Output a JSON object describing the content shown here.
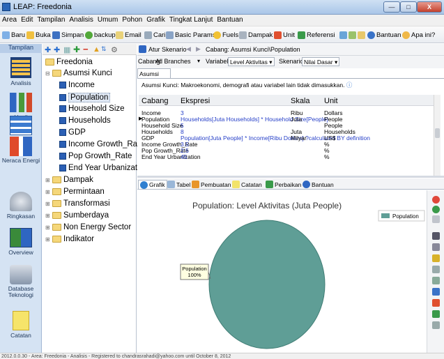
{
  "window": {
    "title": "LEAP: Freedonia"
  },
  "menu": [
    "Area",
    "Edit",
    "Tampilan",
    "Analisis",
    "Umum",
    "Pohon",
    "Grafik",
    "Tingkat Lanjut",
    "Bantuan"
  ],
  "toolbar": {
    "baru": "Baru",
    "buka": "Buka",
    "simpan": "Simpan",
    "backup": "backup",
    "email": "Email",
    "cari": "Cari",
    "basic_params": "Basic Params",
    "fuels": "Fuels",
    "dampak": "Dampak",
    "unit": "Unit",
    "referensi": "Referensi",
    "bantuan": "Bantuan",
    "apa_ini": "Apa ini?"
  },
  "leftbar": {
    "tab": "Tampilan",
    "items": [
      {
        "label": "Analisis",
        "icon": "analysis-icon"
      },
      {
        "label": "Hasil",
        "icon": "results-chart-icon"
      },
      {
        "label": "Diagram",
        "icon": "diagram-icon"
      },
      {
        "label": "Neraca Energi",
        "icon": "energy-balance-icon"
      },
      {
        "label": "Ringkasan",
        "icon": "summary-icon"
      },
      {
        "label": "Overview",
        "icon": "overview-icon"
      },
      {
        "label": "Database Teknologi",
        "icon": "database-icon"
      },
      {
        "label": "Catatan",
        "icon": "notes-icon"
      }
    ]
  },
  "tree": {
    "root": "Freedonia",
    "asumsi": "Asumsi Kunci",
    "vars": [
      "Income",
      "Population",
      "Household Size",
      "Households",
      "GDP",
      "Income Growth_Rate",
      "Pop Growth_Rate",
      "End Year Urbanization"
    ],
    "others": [
      "Dampak",
      "Permintaan",
      "Transformasi",
      "Sumberdaya",
      "Non Energy Sector",
      "Indikator"
    ]
  },
  "header": {
    "atur_skenario": "Atur Skenario",
    "breadcrumb": "Cabang: Asumsi Kunci\\Population",
    "cabang_label": "Cabang:",
    "cabang_value": "All Branches",
    "variabel_label": "Variabel:",
    "variabel_value": "Level Aktivitas",
    "skenario_label": "Skenario:",
    "skenario_value": "Nilai Dasar"
  },
  "panel": {
    "tab": "Asumsi Kunci",
    "description": "Asumsi Kunci: Makroekonomi, demografi atau variabel lain tidak dimasukkan.",
    "columns": [
      "Cabang",
      "Ekspresi",
      "Skala",
      "Unit"
    ],
    "rows": [
      [
        "Income",
        "3",
        "Ribu",
        "Dollars"
      ],
      [
        "Population",
        "Households[Juta Households] * Household Size[People]",
        "Juta",
        "People"
      ],
      [
        "Household Size",
        "5",
        "",
        "People"
      ],
      [
        "Households",
        "8",
        "Juta",
        "Households"
      ],
      [
        "GDP",
        "Population[Juta People] * Income[Ribu Dollars] ?calculated BY definition",
        "Milyar",
        "US$"
      ],
      [
        "Income Growth_Rate",
        "3.5",
        "",
        "%"
      ],
      [
        "Pop Growth_Rate",
        "2.5",
        "",
        "%"
      ],
      [
        "End Year Urbanization",
        "45",
        "",
        "%"
      ]
    ]
  },
  "bottom_tabs": [
    "Grafik",
    "Tabel",
    "Pembuatan",
    "Catatan",
    "Perbaikan",
    "Bantuan"
  ],
  "chart_data": {
    "type": "pie",
    "title": "Population: Level Aktivitas (Juta People)",
    "series": [
      {
        "name": "Population",
        "values": [
          100
        ]
      }
    ],
    "categories": [
      "Population"
    ],
    "slice_label": "Population",
    "slice_percent": "100%",
    "legend": "top-right",
    "colors": {
      "slice": "#5f9e96",
      "slice_edge": "#3f7c74"
    }
  },
  "status": "2012.0.0.30 - Area: Freedonia - Analisis - Registered to chandrasrahadi@yahoo.com until October 8, 2012"
}
